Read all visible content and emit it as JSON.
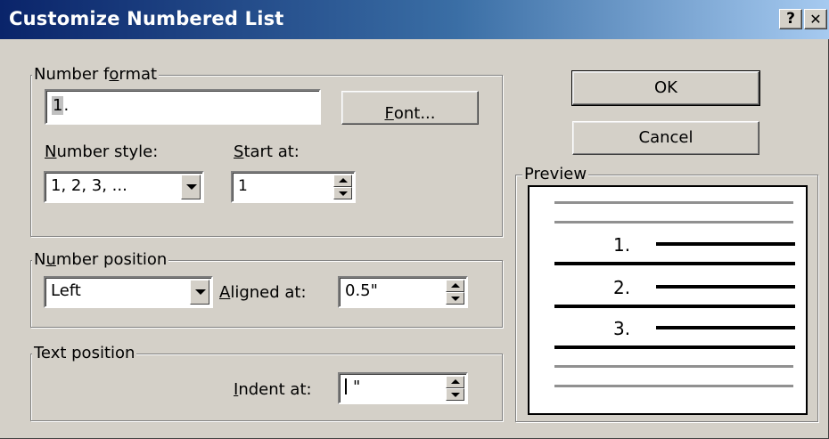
{
  "dialog": {
    "title": "Customize Numbered List",
    "help_glyph": "?",
    "close_glyph": "✕"
  },
  "number_format": {
    "legend_pre": "Number f",
    "legend_key": "o",
    "legend_post": "rmat",
    "value_selected": "1",
    "value_rest": ".",
    "font_button_key": "F",
    "font_button_rest": "ont...",
    "style_label_key": "N",
    "style_label_rest": "umber style:",
    "style_value": "1, 2, 3, ...",
    "start_label_key": "S",
    "start_label_rest": "tart at:",
    "start_value": "1"
  },
  "number_position": {
    "legend_pre": "N",
    "legend_key": "u",
    "legend_post": "mber position",
    "align_value": "Left",
    "aligned_label_key": "A",
    "aligned_label_rest": "ligned at:",
    "aligned_value": "0.5\""
  },
  "text_position": {
    "legend": "Text position",
    "indent_label_key": "I",
    "indent_label_rest": "ndent at:",
    "indent_value": "\""
  },
  "buttons": {
    "ok": "OK",
    "cancel": "Cancel"
  },
  "preview": {
    "legend": "Preview",
    "numbers": [
      "1.",
      "2.",
      "3."
    ]
  },
  "colors": {
    "title_start": "#0a246a",
    "title_end": "#a6caf0",
    "dialog_bg": "#d4d0c8",
    "preview_gray": "#909090"
  }
}
